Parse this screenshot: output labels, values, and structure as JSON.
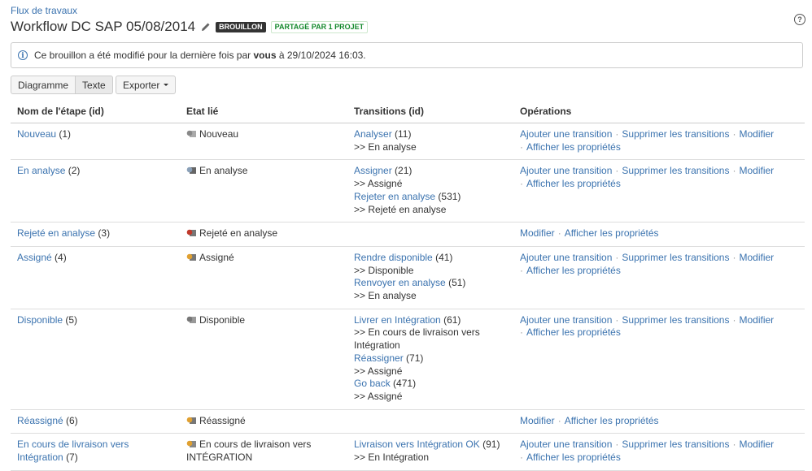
{
  "header": {
    "breadcrumb": "Flux de travaux",
    "title": "Workflow DC SAP 05/08/2014",
    "badge_draft": "BROUILLON",
    "badge_shared": "PARTAGÉ PAR 1 PROJET"
  },
  "notice": {
    "prefix": "Ce brouillon a été modifié pour la dernière fois par",
    "user": "vous",
    "suffix": "à 29/10/2024 16:03."
  },
  "toolbar": {
    "diagram": "Diagramme",
    "text": "Texte",
    "export": "Exporter"
  },
  "table": {
    "headers": [
      "Nom de l'étape (id)",
      "Etat lié",
      "Transitions (id)",
      "Opérations"
    ],
    "ops": {
      "add": "Ajouter une transition",
      "delete": "Supprimer les transitions",
      "edit": "Modifier",
      "props": "Afficher les propriétés",
      "dot": "·"
    },
    "rows": [
      {
        "step": "Nouveau",
        "id": "(1)",
        "state": "Nouveau",
        "transitions": [
          {
            "name": "Analyser",
            "id": "(11)",
            "target": ">> En analyse"
          }
        ]
      },
      {
        "step": "En analyse",
        "id": "(2)",
        "state": "En analyse",
        "transitions": [
          {
            "name": "Assigner",
            "id": "(21)",
            "target": ">> Assigné"
          },
          {
            "name": "Rejeter en analyse",
            "id": "(531)",
            "target": ">> Rejeté en analyse"
          }
        ]
      },
      {
        "step": "Rejeté en analyse",
        "id": "(3)",
        "state": "Rejeté en analyse",
        "transitions": []
      },
      {
        "step": "Assigné",
        "id": "(4)",
        "state": "Assigné",
        "transitions": [
          {
            "name": "Rendre disponible",
            "id": "(41)",
            "target": ">> Disponible"
          },
          {
            "name": "Renvoyer en analyse",
            "id": "(51)",
            "target": ">> En analyse"
          }
        ]
      },
      {
        "step": "Disponible",
        "id": "(5)",
        "state": "Disponible",
        "transitions": [
          {
            "name": "Livrer en Intégration",
            "id": "(61)",
            "target": ">> En cours de livraison vers Intégration"
          },
          {
            "name": "Réassigner",
            "id": "(71)",
            "target": ">> Assigné"
          },
          {
            "name": "Go back",
            "id": "(471)",
            "target": ">> Assigné"
          }
        ]
      },
      {
        "step": "Réassigné",
        "id": "(6)",
        "state": "Réassigné",
        "transitions": []
      },
      {
        "step": "En cours de livraison vers Intégration",
        "id": "(7)",
        "state": "En cours de livraison vers INTÉGRATION",
        "transitions": [
          {
            "name": "Livraison vers Intégration OK",
            "id": "(91)",
            "target": ">> En Intégration"
          }
        ]
      }
    ]
  },
  "colors": {
    "link": "#3b73af",
    "shared_badge": "#14892c",
    "draft_badge": "#333333"
  },
  "icons": [
    "pencil-icon",
    "info-icon",
    "help-icon",
    "status-icon"
  ]
}
